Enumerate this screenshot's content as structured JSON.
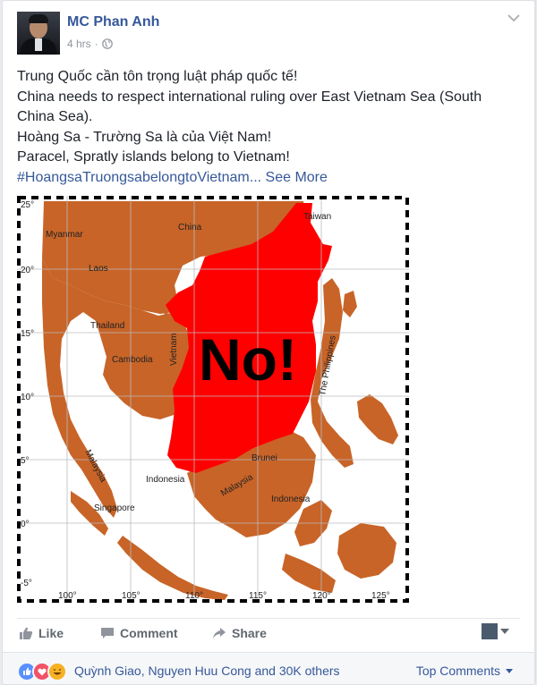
{
  "post": {
    "author": "MC Phan Anh",
    "time": "4 hrs",
    "lines": [
      "Trung Quốc cần tôn trọng luật pháp quốc tế!",
      "China needs to respect international ruling over East Vietnam Sea (South China Sea).",
      "Hoàng Sa - Trường Sa là của Việt Nam!",
      "Paracel, Spratly islands belong to Vietnam!"
    ],
    "hashtag": "#HoangsaTruongsabelongtoVietnam",
    "see_more": "... See More"
  },
  "map": {
    "overlay_text": "No!",
    "colors": {
      "sea": "#ffffff",
      "land": "#c86428",
      "claim": "#ff0000"
    },
    "labels": {
      "taiwan": "Taiwan",
      "myanmar": "Myanmar",
      "china": "China",
      "laos": "Laos",
      "thailand": "Thailand",
      "cambodia": "Cambodia",
      "vietnam": "Vietnam",
      "philippines": "The Philippines",
      "brunei": "Brunei",
      "malaysia_west": "Malaysia",
      "indonesia_west": "Indonesia",
      "malaysia_east": "Malaysia",
      "indonesia_east": "Indonesia",
      "singapore": "Singapore"
    },
    "lat_ticks": [
      "25°",
      "20°",
      "15°",
      "10°",
      "5°",
      "0°",
      "-5°"
    ],
    "lon_ticks": [
      "100°",
      "105°",
      "110°",
      "115°",
      "120°",
      "125°"
    ]
  },
  "actions": {
    "like": "Like",
    "comment": "Comment",
    "share": "Share"
  },
  "reactions": {
    "summary": "Quỳnh Giao, Nguyen Huu Cong and 30K others",
    "top_comments": "Top Comments",
    "colors": {
      "like": "#5890ff",
      "love": "#f25268",
      "haha": "#f7b125"
    }
  },
  "theme": {
    "link": "#365899",
    "muted": "#90949c"
  }
}
